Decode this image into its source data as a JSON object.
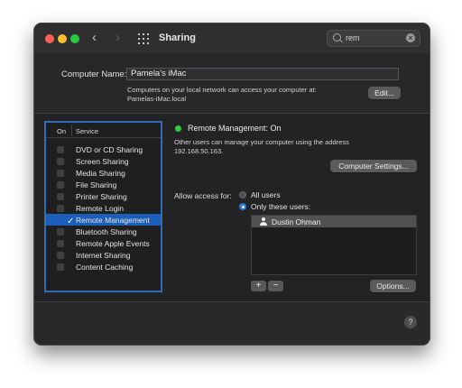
{
  "window": {
    "title": "Sharing",
    "back_glyph": "‹",
    "forward_glyph": "›",
    "search": {
      "value": "rem",
      "clear_glyph": "×"
    }
  },
  "computer_name": {
    "label": "Computer Name:",
    "value": "Pamela's iMac",
    "desc_line1": "Computers on your local network can access your computer at:",
    "desc_line2": "Pamelas-iMac.local",
    "edit_label": "Edit..."
  },
  "services": {
    "header_on": "On",
    "header_service": "Service",
    "items": [
      {
        "label": "DVD or CD Sharing",
        "checked": false
      },
      {
        "label": "Screen Sharing",
        "checked": false
      },
      {
        "label": "Media Sharing",
        "checked": false
      },
      {
        "label": "File Sharing",
        "checked": false
      },
      {
        "label": "Printer Sharing",
        "checked": false
      },
      {
        "label": "Remote Login",
        "checked": false
      },
      {
        "label": "Remote Management",
        "checked": true,
        "selected": true
      },
      {
        "label": "Bluetooth Sharing",
        "checked": false
      },
      {
        "label": "Remote Apple Events",
        "checked": false
      },
      {
        "label": "Internet Sharing",
        "checked": false
      },
      {
        "label": "Content Caching",
        "checked": false
      }
    ],
    "check_glyph": "✓"
  },
  "detail": {
    "status": "Remote Management: On",
    "status_color": "#2fce45",
    "info_line1": "Other users can manage your computer using the address",
    "info_line2": "192.168.50.163.",
    "computer_settings_label": "Computer Settings...",
    "allow_label": "Allow access for:",
    "option_all": "All users",
    "option_only": "Only these users:",
    "selected_option": "Only these users:",
    "users": [
      "Dustin Ohman"
    ],
    "add_glyph": "+",
    "remove_glyph": "−",
    "options_label": "Options..."
  },
  "footer": {
    "help_glyph": "?"
  },
  "colors": {
    "accent": "#1c5fb8",
    "panel_border": "#2f6db5",
    "traffic_red": "#ff5f57",
    "traffic_yellow": "#febc2e",
    "traffic_green": "#28c840"
  }
}
